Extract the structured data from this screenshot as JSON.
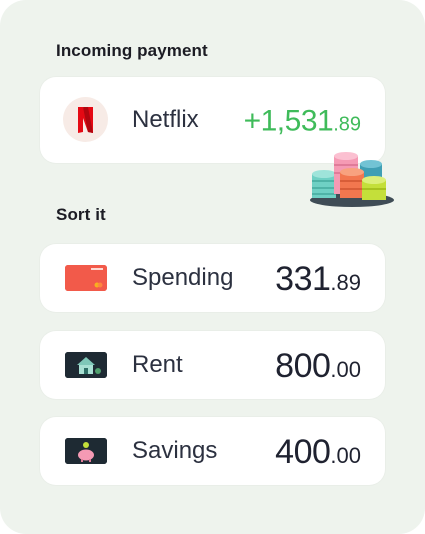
{
  "incoming": {
    "title": "Incoming payment",
    "merchant": "Netflix",
    "amount_main": "+1,531",
    "amount_cents": ".89",
    "amount_color": "#3fbb5a",
    "logo_icon": "netflix-logo-icon"
  },
  "sort": {
    "title": "Sort it",
    "items": [
      {
        "label": "Spending",
        "amount_main": "331",
        "amount_cents": ".89",
        "icon": "card-icon"
      },
      {
        "label": "Rent",
        "amount_main": "800",
        "amount_cents": ".00",
        "icon": "house-icon"
      },
      {
        "label": "Savings",
        "amount_main": "400",
        "amount_cents": ".00",
        "icon": "piggy-bank-icon"
      }
    ]
  },
  "colors": {
    "panel_bg": "#eef3ed",
    "card_bg": "#ffffff",
    "text": "#1f2230",
    "netflix_red": "#e50914",
    "spending_card": "#f25a4a",
    "dark_thumb": "#1e2a33"
  }
}
